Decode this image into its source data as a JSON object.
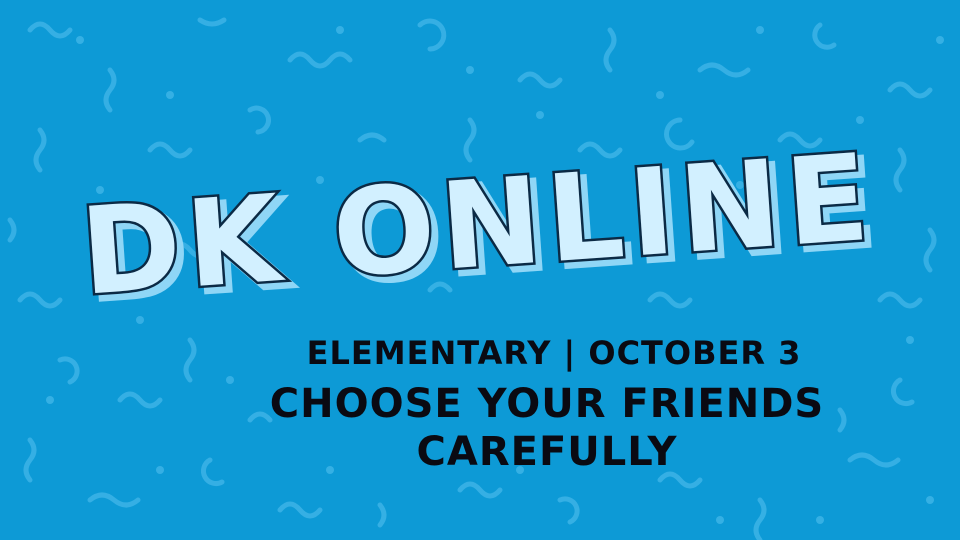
{
  "title": "DK ONLINE",
  "subtitle": "ELEMENTARY | OCTOBER 3",
  "heading_line1": "CHOOSE YOUR FRIENDS",
  "heading_line2": "CAREFULLY",
  "colors": {
    "background": "#0d9ad6",
    "pattern": "#3ab2e6",
    "title_fill": "#d2f0ff",
    "title_outline": "#0b2a45",
    "title_shadow": "#8fd6f6",
    "text": "#0a0a12"
  }
}
